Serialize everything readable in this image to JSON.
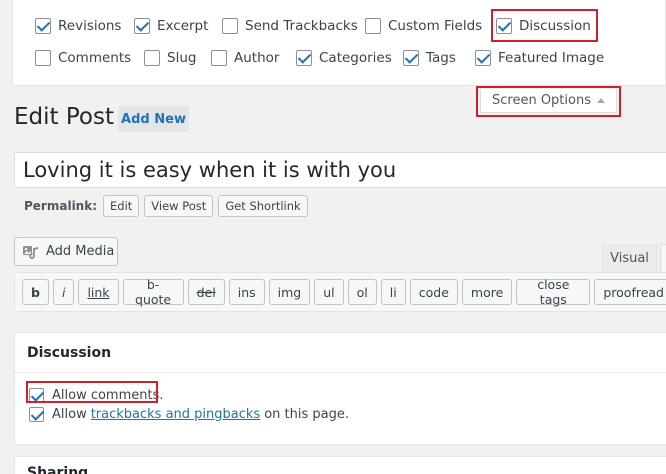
{
  "screen_options": {
    "row1": [
      {
        "label": "Revisions",
        "checked": true
      },
      {
        "label": "Excerpt",
        "checked": true
      },
      {
        "label": "Send Trackbacks",
        "checked": false
      },
      {
        "label": "Custom Fields",
        "checked": false
      },
      {
        "label": "Discussion",
        "checked": true
      }
    ],
    "row2": [
      {
        "label": "Comments",
        "checked": false
      },
      {
        "label": "Slug",
        "checked": false
      },
      {
        "label": "Author",
        "checked": false
      },
      {
        "label": "Categories",
        "checked": true
      },
      {
        "label": "Tags",
        "checked": true
      },
      {
        "label": "Featured Image",
        "checked": true
      }
    ],
    "toggle_label": "Screen Options"
  },
  "header": {
    "title": "Edit Post",
    "add_new": "Add New"
  },
  "post": {
    "title_value": "Loving it is easy when it is with you",
    "permalink_label": "Permalink:",
    "permalink_buttons": [
      "Edit",
      "View Post",
      "Get Shortlink"
    ]
  },
  "editor": {
    "add_media": "Add Media",
    "tab_visual": "Visual",
    "quicktags": [
      "b",
      "i",
      "link",
      "b-quote",
      "del",
      "ins",
      "img",
      "ul",
      "ol",
      "li",
      "code",
      "more",
      "close tags",
      "proofread"
    ]
  },
  "discussion": {
    "title": "Discussion",
    "allow_comments": "Allow comments.",
    "allow_pre": "Allow",
    "trackbacks_link": "trackbacks and pingbacks",
    "allow_post": "on this page.",
    "allow_comments_checked": true,
    "allow_trackbacks_checked": true
  },
  "sharing": {
    "title": "Sharing"
  },
  "colors": {
    "highlight": "#d11f2b",
    "link": "#2271b1"
  }
}
